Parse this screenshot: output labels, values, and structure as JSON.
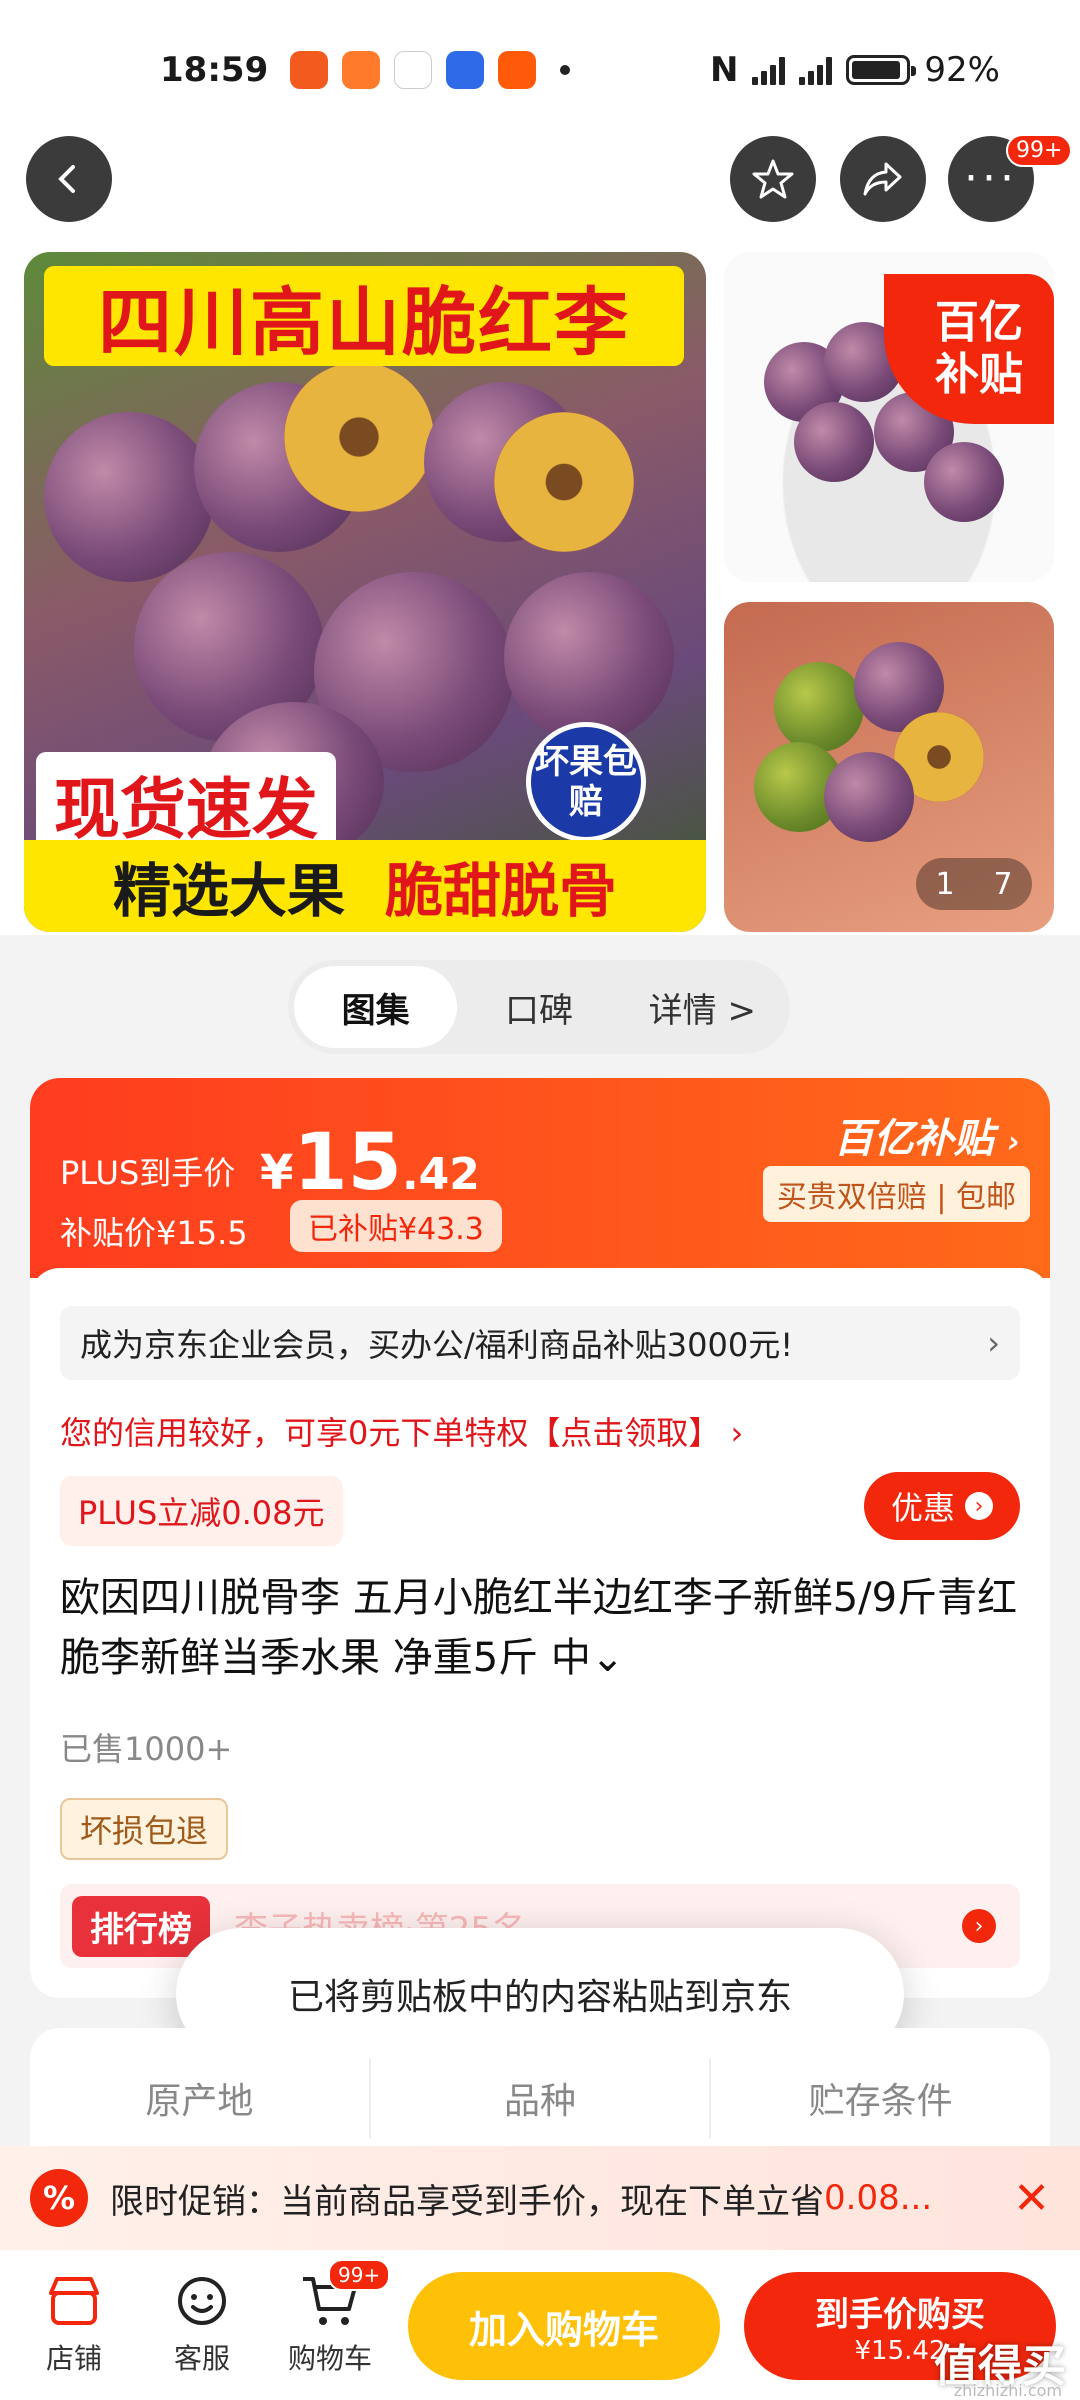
{
  "status_bar": {
    "time": "18:59",
    "battery": "92%",
    "battery_level": 0.92,
    "network": "5G"
  },
  "top_nav": {
    "cart_badge": "99+"
  },
  "gallery": {
    "main_title": "四川高山脆红李",
    "tag_left": "现货速发",
    "badge": "坏果包赔",
    "bottom_left": "精选大果",
    "bottom_right": "脆甜脱骨",
    "subsidy_line1": "百亿",
    "subsidy_line2": "补贴",
    "page_current": "1",
    "page_total": "7"
  },
  "tabs": [
    {
      "label": "图集"
    },
    {
      "label": "口碑"
    },
    {
      "label": "详情 >"
    }
  ],
  "price": {
    "plus_label": "PLUS到手价",
    "currency": "¥",
    "value_int": "15",
    "value_dec": ".42",
    "subsidy_price": "补贴价¥15.5",
    "subsidized": "已补贴¥43.3",
    "brand": "百亿补贴",
    "brand_sub": "买贵双倍赔 | 包邮"
  },
  "info": {
    "enterprise": "成为京东企业会员，买办公/福利商品补贴3000元!",
    "enterprise_chevron": "›",
    "credit": "您的信用较好，可享0元下单特权【点击领取】 ›",
    "plus_discount": "PLUS立减0.08元",
    "coupon": "优惠",
    "title": "欧因四川脱骨李 五月小脆红半边红李子新鲜5/9斤青红脆李新鲜当季水果 净重5斤  中⌄",
    "sold": "已售1000+",
    "refund": "坏损包退",
    "rank_tag": "排行榜",
    "rank_text": "李子热卖榜·第25名"
  },
  "toast": "已将剪贴板中的内容粘贴到京东",
  "attributes": [
    "原产地",
    "品种",
    "贮存条件"
  ],
  "promo": {
    "prefix": "限时促销：当前商品享受到手价，现在下单立省",
    "save": "0.08...",
    "close": "✕"
  },
  "bottom_bar": {
    "store": "店铺",
    "service": "客服",
    "cart": "购物车",
    "cart_badge": "99+",
    "add_cart": "加入购物车",
    "buy_label": "到手价购买",
    "buy_price": "¥15.42",
    "watermark": "值得买",
    "watermark_url": "zhizhizhi.com"
  },
  "colors": {
    "accent": "#f2270c",
    "yellow": "#ffc107"
  }
}
